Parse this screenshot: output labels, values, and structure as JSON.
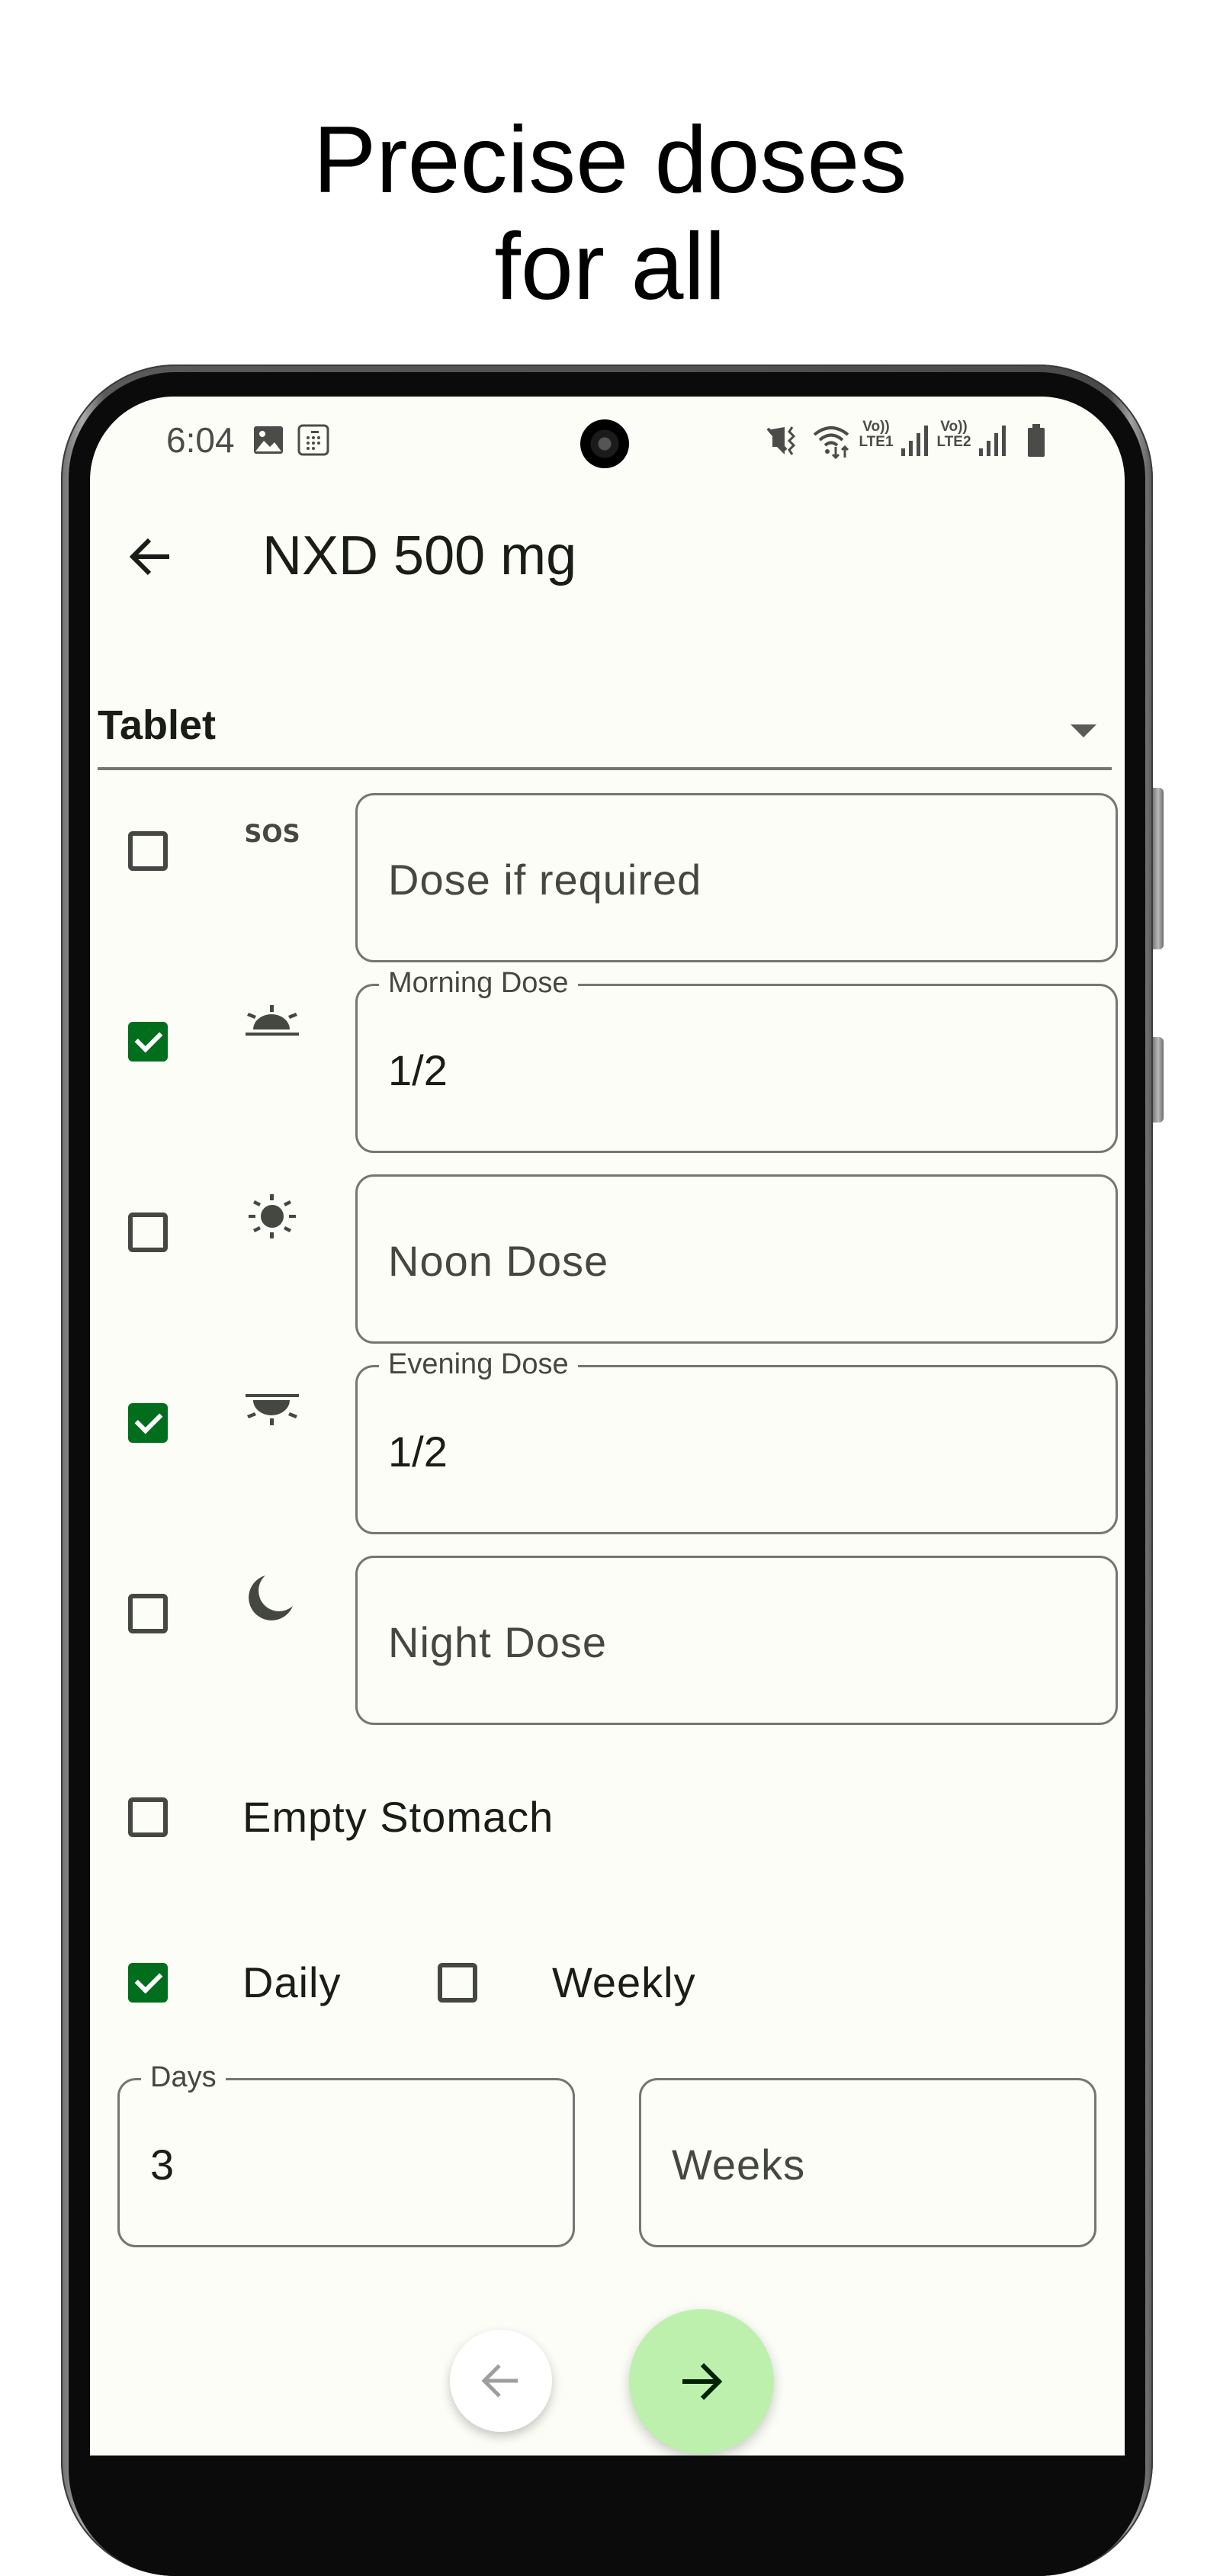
{
  "headline": {
    "line1": "Precise doses",
    "line2": "for all"
  },
  "status_bar": {
    "time": "6:04",
    "left_icons": [
      "image-notification-icon",
      "calendar-grid-notification-icon"
    ],
    "right_icons": [
      "mute-vibrate-icon",
      "wifi-data-icon",
      "volte-lte1-icon",
      "signal-1-icon",
      "volte-lte2-icon",
      "signal-2-icon",
      "battery-icon"
    ],
    "lte1_top": "Vo))",
    "lte1_bottom": "LTE1",
    "lte2_top": "Vo))",
    "lte2_bottom": "LTE2"
  },
  "app_bar": {
    "back_icon": "arrow-left-icon",
    "title": "NXD 500 mg"
  },
  "form_dropdown": {
    "selected": "Tablet"
  },
  "dose_rows": [
    {
      "id": "sos",
      "icon": "sos-icon",
      "checked": false,
      "label": "",
      "placeholder": "Dose if required",
      "value": ""
    },
    {
      "id": "morning",
      "icon": "sunrise-icon",
      "checked": true,
      "label": "Morning Dose",
      "placeholder": "",
      "value": "1/2"
    },
    {
      "id": "noon",
      "icon": "sun-icon",
      "checked": false,
      "label": "",
      "placeholder": "Noon Dose",
      "value": ""
    },
    {
      "id": "evening",
      "icon": "sunset-icon",
      "checked": true,
      "label": "Evening Dose",
      "placeholder": "",
      "value": "1/2"
    },
    {
      "id": "night",
      "icon": "moon-icon",
      "checked": false,
      "label": "",
      "placeholder": "Night Dose",
      "value": ""
    }
  ],
  "empty_stomach": {
    "label": "Empty Stomach",
    "checked": false
  },
  "frequency": {
    "daily": {
      "label": "Daily",
      "checked": true
    },
    "weekly": {
      "label": "Weekly",
      "checked": false
    }
  },
  "duration": {
    "days": {
      "label": "Days",
      "value": "3"
    },
    "weeks": {
      "placeholder": "Weeks",
      "value": ""
    }
  },
  "nav": {
    "prev_icon": "arrow-left-icon",
    "next_icon": "arrow-right-icon"
  },
  "colors": {
    "checkbox_checked": "#006e1c",
    "fab_next": "#bdf0ad",
    "screen_bg": "#fcfdf7",
    "outline": "#747672"
  }
}
